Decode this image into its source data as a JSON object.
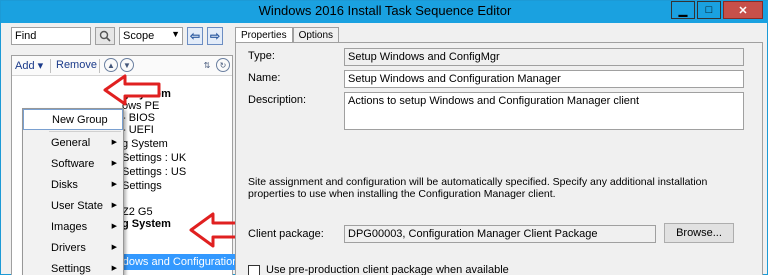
{
  "window": {
    "title": "Windows 2016 Install Task Sequence Editor"
  },
  "search": {
    "find_value": "Find",
    "scope_value": "Scope"
  },
  "toolbar": {
    "add_label": "Add",
    "remove_label": "Remove"
  },
  "tree_partial": [
    "g System",
    "ows PE",
    "- BIOS",
    "- UEFI",
    "g System",
    "Settings : UK",
    "Settings : US",
    "Settings",
    "",
    "Z2 G5",
    "g System"
  ],
  "add_menu": {
    "items": [
      {
        "label": "New Group",
        "has_submenu": false
      },
      {
        "label": "General",
        "has_submenu": true
      },
      {
        "label": "Software",
        "has_submenu": true
      },
      {
        "label": "Disks",
        "has_submenu": true
      },
      {
        "label": "User State",
        "has_submenu": true
      },
      {
        "label": "Images",
        "has_submenu": true
      },
      {
        "label": "Drivers",
        "has_submenu": true
      },
      {
        "label": "Settings",
        "has_submenu": true
      }
    ]
  },
  "selected_step": "Setup Windows and Configuration Manager",
  "tabs": [
    "Properties",
    "Options"
  ],
  "properties": {
    "type_label": "Type:",
    "type_value": "Setup Windows and ConfigMgr",
    "name_label": "Name:",
    "name_value": "Setup Windows and Configuration Manager",
    "description_label": "Description:",
    "description_value": "Actions to setup Windows and Configuration Manager client",
    "info_text": "Site assignment and configuration will be automatically specified. Specify any additional installation properties to use when installing the Configuration Manager client.",
    "client_package_label": "Client package:",
    "client_package_value": "DPG00003, Configuration Manager Client Package",
    "browse_label": "Browse...",
    "preprod_label": "Use pre-production client package when available"
  },
  "colors": {
    "titlebar": "#1aa1e0",
    "selection": "#3399ff",
    "annotation_arrow": "#e02020"
  }
}
